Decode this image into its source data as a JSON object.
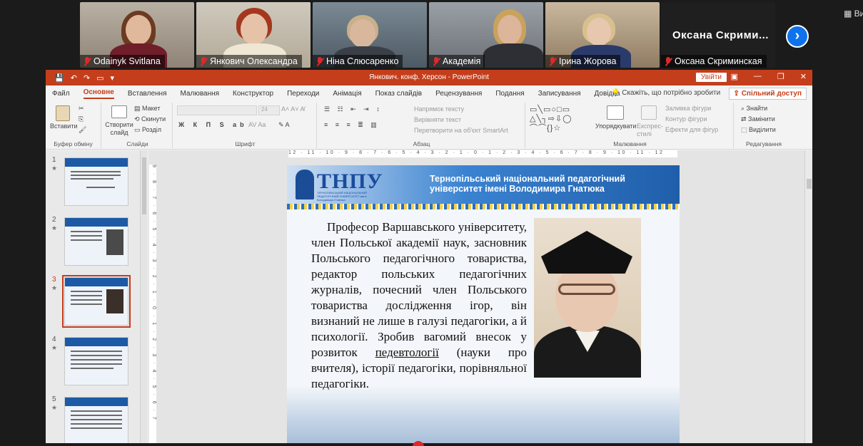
{
  "participants": [
    {
      "name": "Odainyk Svitlana",
      "muted": true
    },
    {
      "name": "Янкович Олександра",
      "muted": true,
      "active": true
    },
    {
      "name": "Ніна Слюсаренко",
      "muted": true
    },
    {
      "name": "Академія",
      "muted": true
    },
    {
      "name": "Ірина Жорова",
      "muted": true
    },
    {
      "name": "Оксана Скриминская",
      "muted": true
    }
  ],
  "big_name_tile": "Оксана Скрими...",
  "zoom_view_label": "Ви",
  "powerpoint": {
    "title": "Янкович. конф. Херсон  -  PowerPoint",
    "sign_in": "Увійти",
    "tabs": [
      "Файл",
      "Основне",
      "Вставлення",
      "Малювання",
      "Конструктор",
      "Переходи",
      "Анімація",
      "Показ слайдів",
      "Рецензування",
      "Подання",
      "Записування",
      "Довідка"
    ],
    "selected_tab": "Основне",
    "tell_me": "Скажіть, що потрібно зробити",
    "share": "Спільний доступ",
    "ribbon": {
      "paste": "Вставити",
      "clipboard_group": "Буфер обміну",
      "new_slide": "Створити слайд",
      "layout": "Макет",
      "reset": "Скинути",
      "section": "Розділ",
      "slides_group": "Слайди",
      "font_size": "24",
      "font_group": "Шрифт",
      "text_direction": "Напрямок тексту",
      "align_text": "Вирівняти текст",
      "convert_smartart": "Перетворити на об'єкт SmartArt",
      "paragraph_group": "Абзац",
      "arrange": "Упорядкувати",
      "quick_styles": "Експрес-стилі",
      "shape_fill": "Заливка фігури",
      "shape_outline": "Контур фігури",
      "shape_effects": "Ефекти для фігур",
      "drawing_group": "Малювання",
      "find": "Знайти",
      "replace": "Замінити",
      "select": "Виділити",
      "editing_group": "Редагування"
    },
    "thumbnails": [
      {
        "number": "1",
        "star": "★"
      },
      {
        "number": "2",
        "star": "★"
      },
      {
        "number": "3",
        "star": "★",
        "selected": true
      },
      {
        "number": "4",
        "star": "★"
      },
      {
        "number": "5",
        "star": "★"
      }
    ],
    "ruler_h": "12 · 11 · 10 · 9 · 8 · 7 · 6 · 5 · 4 · 3 · 2 · 1 · 0 · 1 · 2 · 3 · 4 · 5 · 6 · 7 · 8 · 9 · 10 · 11 · 12",
    "ruler_v": "9 · 8 · 7 · 6 · 5 · 4 · 3 · 2 · 1 · 0 · 1 · 2 · 3 · 4 · 5 · 6 · 7"
  },
  "slide": {
    "logo": "ТНПУ",
    "logo_subtitle": "ТЕРНОПІЛЬСЬКИЙ НАЦІОНАЛЬНИЙ ПЕДАГОГІЧНИЙ УНІВЕРСИТЕТ імені Володимира Гнатюка",
    "header": "Тернопільський національний педагогічний університет імені Володимира Гнатюка",
    "body_before": "Професор Варшавського університету, член Польської академії наук, засновник Польського педагогічного товариства, редактор польських педагогічних журналів, почесний член Польського товариства дослідження ігор, він визнаний не лише в галузі педагогіки, а й психології. Зробив вагомий внесок у розвиток ",
    "body_underlined": "педевтології",
    "body_after": " (науки про вчителя), історії педагогіки, порівняльної педагогіки."
  },
  "colors": {
    "ppt_accent": "#c43e1c",
    "zoom_blue": "#0e72ed",
    "muted_red": "#e02828",
    "slide_blue": "#1f5eaa"
  }
}
